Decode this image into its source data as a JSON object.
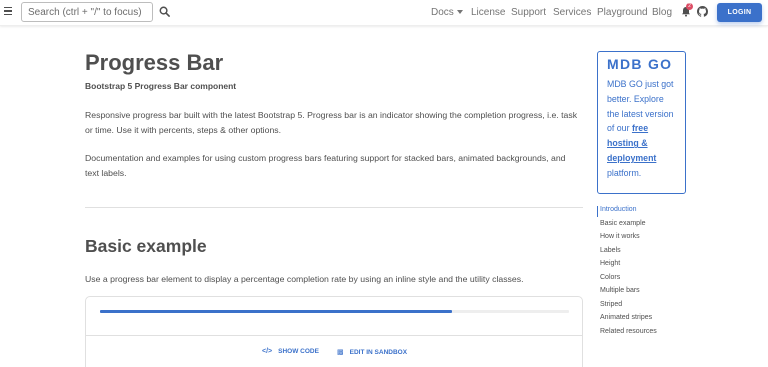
{
  "navbar": {
    "search_placeholder": "Search (ctrl + \"/\" to focus)",
    "links": [
      "Docs",
      "License",
      "Support",
      "Services",
      "Playground",
      "Blog"
    ],
    "notification_count": "2",
    "login_label": "LOGIN"
  },
  "main": {
    "title": "Progress Bar",
    "subtitle": "Bootstrap 5 Progress Bar component",
    "intro": "Responsive progress bar built with the latest Bootstrap 5. Progress bar is an indicator showing the completion progress, i.e. task or time. Use it with percents, steps & other options.",
    "description": "Documentation and examples for using custom progress bars featuring support for stacked bars, animated backgrounds, and text labels.",
    "section_title": "Basic example",
    "section_text": "Use a progress bar element to display a percentage completion rate by using an inline style and the utility classes.",
    "progress_value": 75,
    "show_code_label": "SHOW CODE",
    "edit_sandbox_label": "EDIT IN SANDBOX"
  },
  "promo": {
    "logo": "MDB GO",
    "text_before": "MDB GO just got better. Explore the latest version of our",
    "link_text": "free hosting & deployment",
    "text_after": "platform."
  },
  "toc": {
    "items": [
      "Introduction",
      "Basic example",
      "How it works",
      "Labels",
      "Height",
      "Colors",
      "Multiple bars",
      "Striped",
      "Animated stripes",
      "Related resources"
    ],
    "active": "Introduction"
  },
  "colors": {
    "primary": "#3b71ca",
    "text": "#4f4f4f",
    "badge": "#dc4c64"
  }
}
